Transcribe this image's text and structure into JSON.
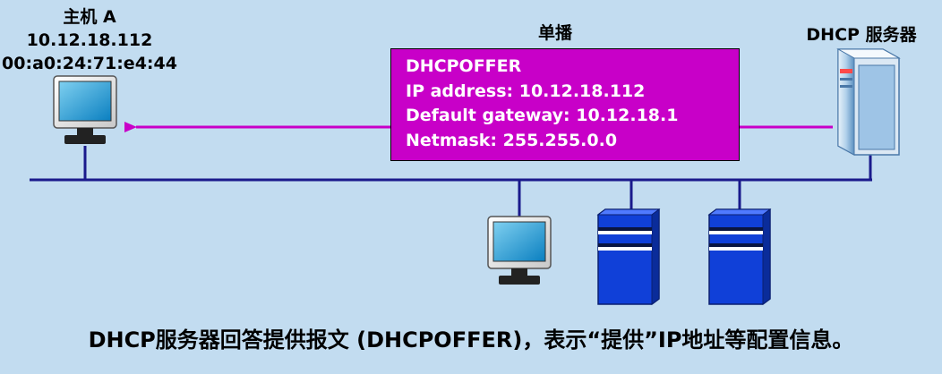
{
  "host_a": {
    "name": "主机 A",
    "ip": "10.12.18.112",
    "mac": "00:a0:24:71:e4:44"
  },
  "unicast_label": "单播",
  "server_label": "DHCP 服务器",
  "message": {
    "lines": [
      "DHCPOFFER",
      "IP address: 10.12.18.112",
      "Default gateway: 10.12.18.1",
      "Netmask: 255.255.0.0"
    ]
  },
  "caption": "DHCP服务器回答提供报文 (DHCPOFFER)，表示“提供”IP地址等配置信息。",
  "colors": {
    "background": "#c2dcf0",
    "network_line": "#1a1a8c",
    "arrow": "#c800c8",
    "message_box": "#c800c8",
    "server_blue": "#1040d8"
  }
}
